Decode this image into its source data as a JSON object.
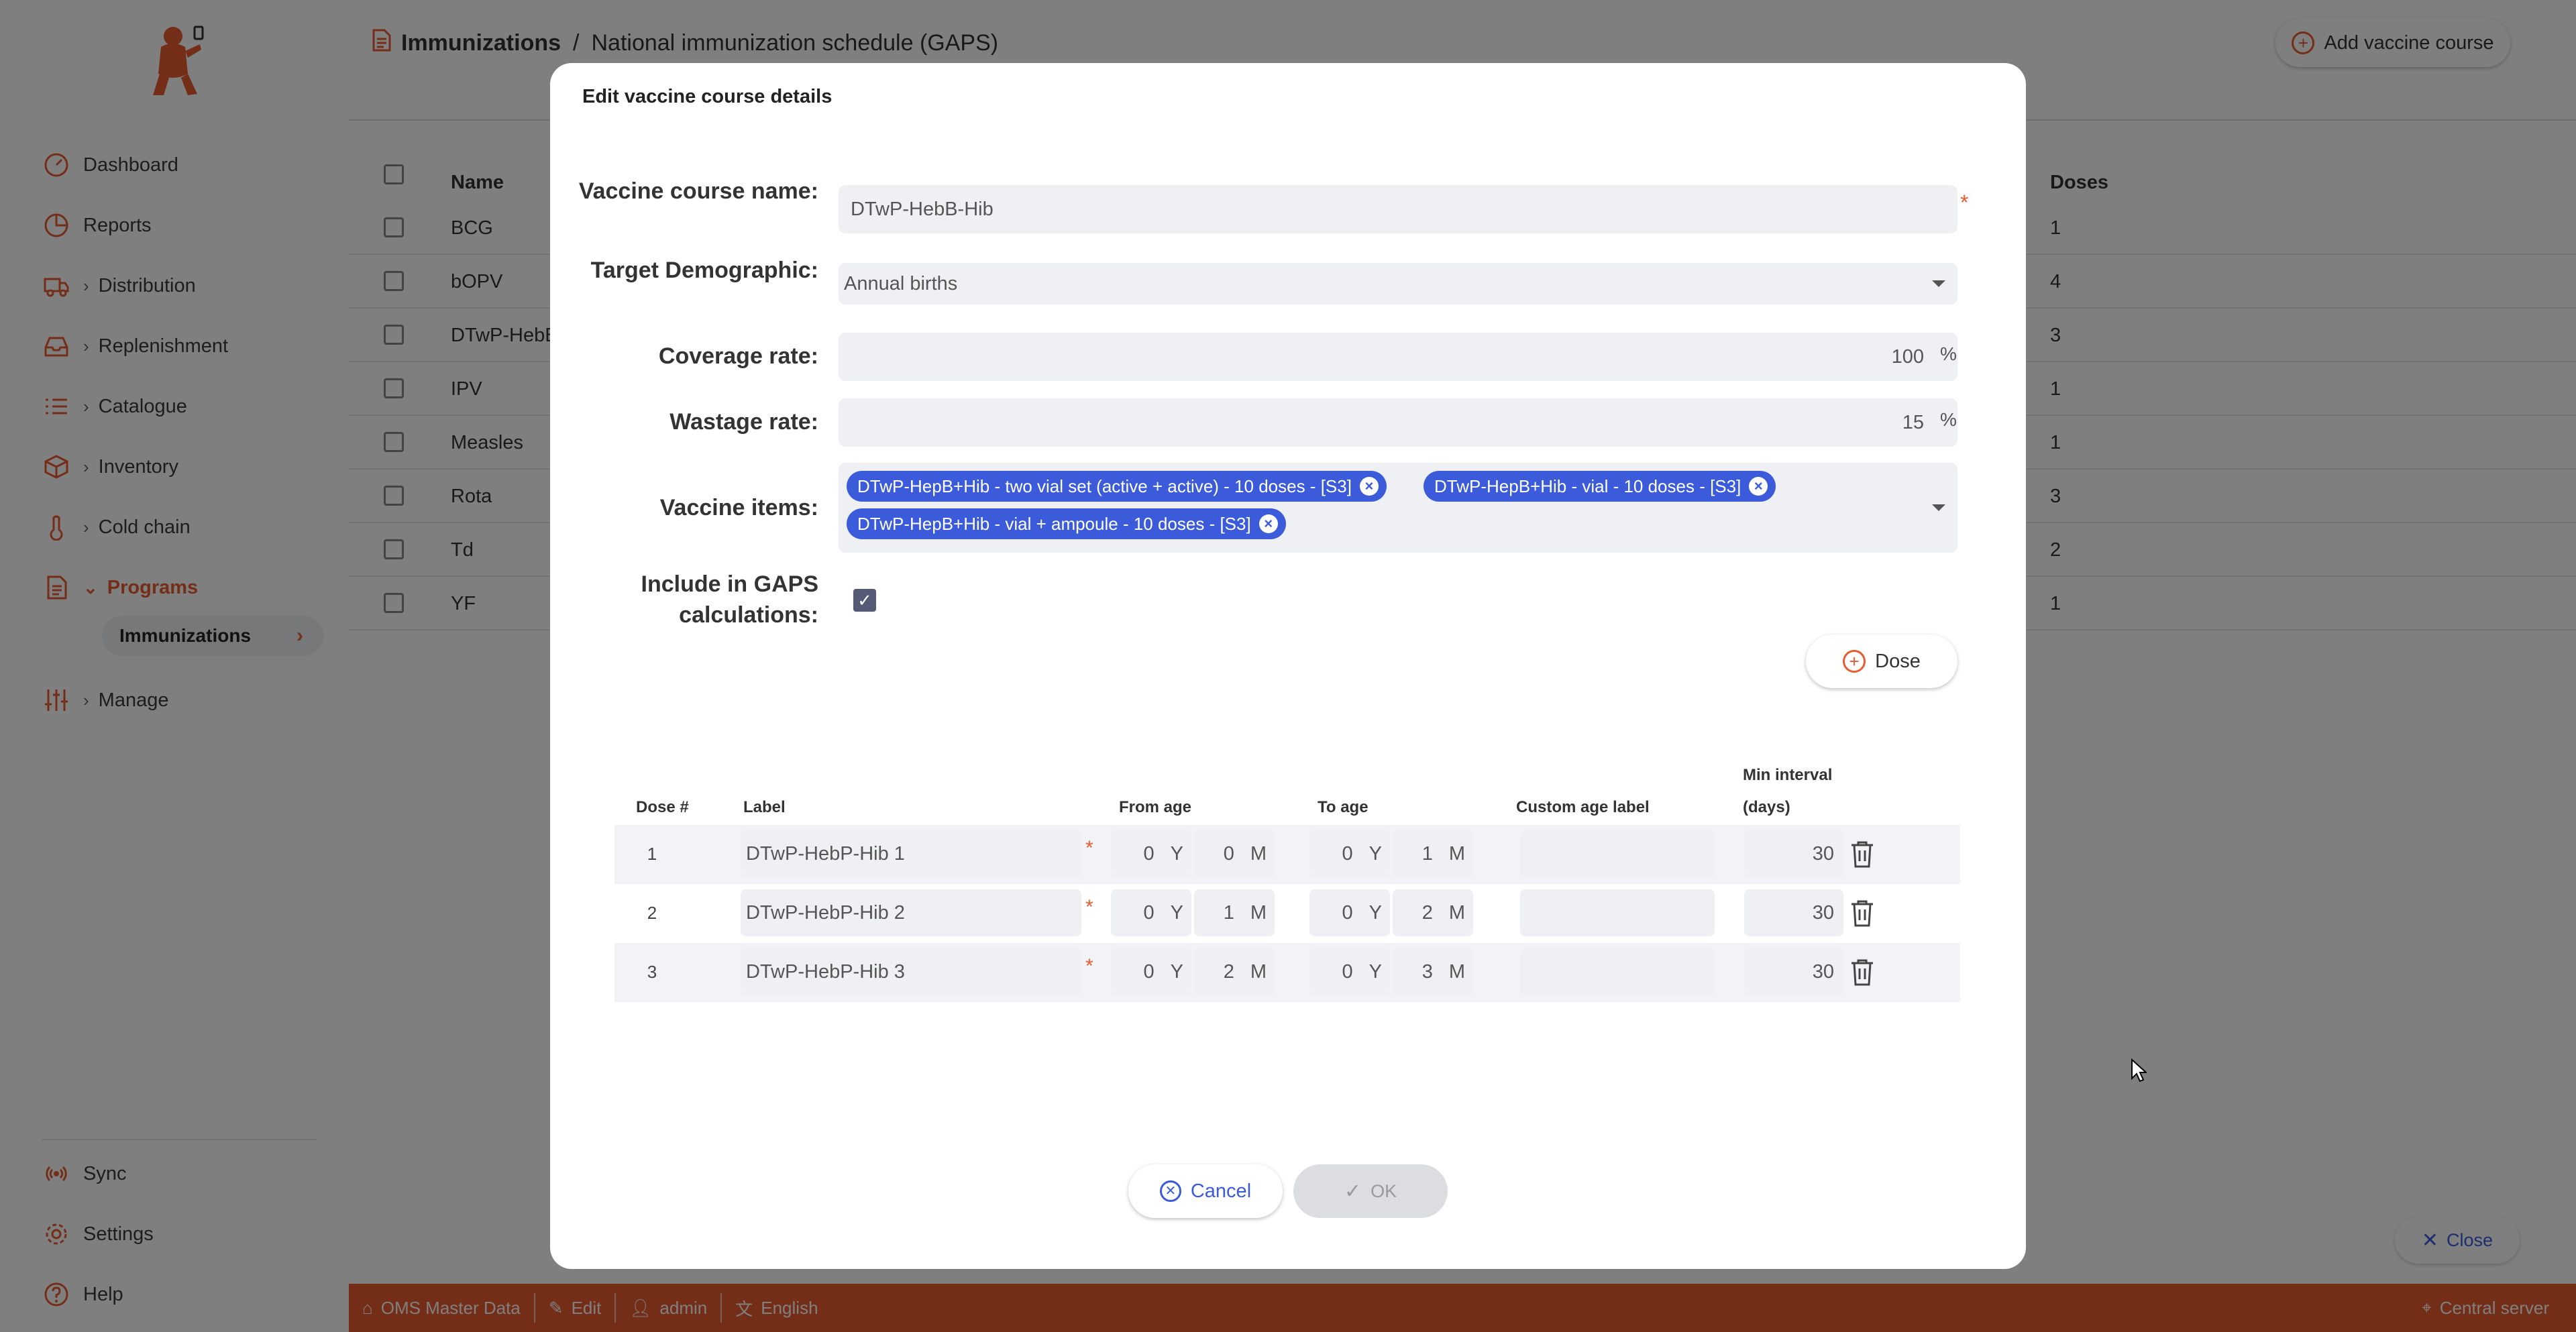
{
  "sidebar": {
    "items": [
      {
        "label": "Dashboard",
        "icon": "dashboard-icon"
      },
      {
        "label": "Reports",
        "icon": "reports-icon"
      },
      {
        "label": "Distribution",
        "icon": "truck-icon"
      },
      {
        "label": "Replenishment",
        "icon": "inbox-icon"
      },
      {
        "label": "Catalogue",
        "icon": "list-icon"
      },
      {
        "label": "Inventory",
        "icon": "box-icon"
      },
      {
        "label": "Cold chain",
        "icon": "thermometer-icon"
      },
      {
        "label": "Programs",
        "icon": "document-icon"
      },
      {
        "label": "Manage",
        "icon": "sliders-icon"
      }
    ],
    "sub_item": "Immunizations",
    "bottom": [
      {
        "label": "Sync",
        "icon": "sync-icon"
      },
      {
        "label": "Settings",
        "icon": "gear-icon"
      },
      {
        "label": "Help",
        "icon": "help-icon"
      }
    ]
  },
  "header": {
    "breadcrumb_root": "Immunizations",
    "breadcrumb_sep": "/",
    "breadcrumb_current": "National immunization schedule (GAPS)",
    "add_button": "Add vaccine course"
  },
  "table": {
    "col_name": "Name",
    "col_doses": "Doses",
    "rows": [
      {
        "name": "BCG",
        "doses": "1"
      },
      {
        "name": "bOPV",
        "doses": "4"
      },
      {
        "name": "DTwP-HebB-Hib",
        "doses": "3"
      },
      {
        "name": "IPV",
        "doses": "1"
      },
      {
        "name": "Measles",
        "doses": "1"
      },
      {
        "name": "Rota",
        "doses": "3"
      },
      {
        "name": "Td",
        "doses": "2"
      },
      {
        "name": "YF",
        "doses": "1"
      }
    ]
  },
  "close_button": "Close",
  "footer": {
    "store": "OMS Master Data",
    "mode": "Edit",
    "user": "admin",
    "language": "English",
    "server": "Central server"
  },
  "modal": {
    "title": "Edit vaccine course details",
    "name_label": "Vaccine course name:",
    "name_value": "DTwP-HebB-Hib",
    "demographic_label": "Target Demographic:",
    "demographic_value": "Annual births",
    "coverage_label": "Coverage rate:",
    "coverage_value": "100",
    "wastage_label": "Wastage rate:",
    "wastage_value": "15",
    "percent": "%",
    "required_mark": "*",
    "items_label": "Vaccine items:",
    "items": [
      "DTwP-HepB+Hib - two vial set (active + active) - 10 doses - [S3]",
      "DTwP-HepB+Hib - vial - 10 doses - [S3]",
      "DTwP-HepB+Hib - vial + ampoule - 10 doses - [S3]"
    ],
    "gaps_label": "Include in GAPS calculations:",
    "gaps_checked": true,
    "dose_button": "Dose",
    "dose_headers": {
      "num": "Dose #",
      "label": "Label",
      "from": "From age",
      "to": "To age",
      "custom": "Custom age label",
      "interval_1": "Min interval",
      "interval_2": "(days)"
    },
    "year_unit": "Y",
    "month_unit": "M",
    "doses": [
      {
        "num": "1",
        "label": "DTwP-HebP-Hib 1",
        "from_y": "0",
        "from_m": "0",
        "to_y": "0",
        "to_m": "1",
        "custom": "",
        "interval": "30"
      },
      {
        "num": "2",
        "label": "DTwP-HebP-Hib 2",
        "from_y": "0",
        "from_m": "1",
        "to_y": "0",
        "to_m": "2",
        "custom": "",
        "interval": "30"
      },
      {
        "num": "3",
        "label": "DTwP-HebP-Hib 3",
        "from_y": "0",
        "from_m": "2",
        "to_y": "0",
        "to_m": "3",
        "custom": "",
        "interval": "30"
      }
    ],
    "cancel": "Cancel",
    "ok": "OK"
  },
  "colors": {
    "brand": "#e95c30",
    "accent": "#3b5bdb"
  }
}
